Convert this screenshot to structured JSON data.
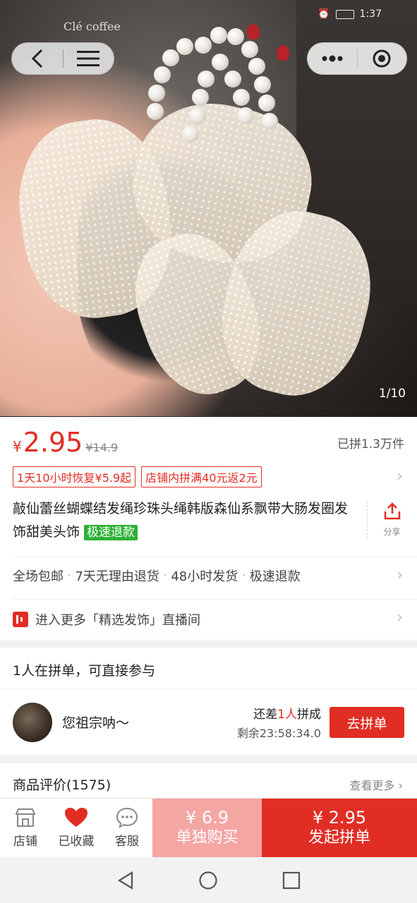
{
  "status_bar": {
    "time": "1:37"
  },
  "hero": {
    "sign_text": "Clé coffee",
    "image_counter": "1/10"
  },
  "capsule": {
    "back_icon": "back-chevron-icon",
    "menu_icon": "hamburger-menu-icon",
    "more_icon": "more-dots-icon",
    "close_icon": "target-close-icon"
  },
  "price": {
    "currency": "¥",
    "current": "2.95",
    "original": "¥14.9",
    "sold": "已拼1.3万件"
  },
  "tags": [
    "1天10小时恢复¥5.9起",
    "店铺内拼满40元返2元"
  ],
  "product": {
    "title": "敲仙蕾丝蝴蝶结发绳珍珠头绳韩版森仙系飘带大肠发圈发饰甜美头饰",
    "fast_refund_badge": "极速退款",
    "share_label": "分享"
  },
  "services": [
    "全场包邮",
    "7天无理由退货",
    "48小时发货",
    "极速退款"
  ],
  "live": {
    "text": "进入更多「精选发饰」直播间"
  },
  "group_buy": {
    "title": "1人在拼单，可直接参与",
    "user_name": "您祖宗呐～",
    "need_prefix": "还差",
    "need_count": "1人",
    "need_suffix": "拼成",
    "remaining": "剩余23:58:34.0",
    "join_label": "去拼单"
  },
  "reviews": {
    "title": "商品评价(1575)",
    "more": "查看更多"
  },
  "bottom_bar": {
    "store_label": "店铺",
    "favorited_label": "已收藏",
    "service_label": "客服",
    "single_price": "¥ 6.9",
    "single_label": "单独购买",
    "group_price": "¥ 2.95",
    "group_label": "发起拼单"
  },
  "colors": {
    "accent": "#e02e24",
    "green_badge": "#2eb135",
    "single_buy_bg": "#f4a6a3"
  }
}
